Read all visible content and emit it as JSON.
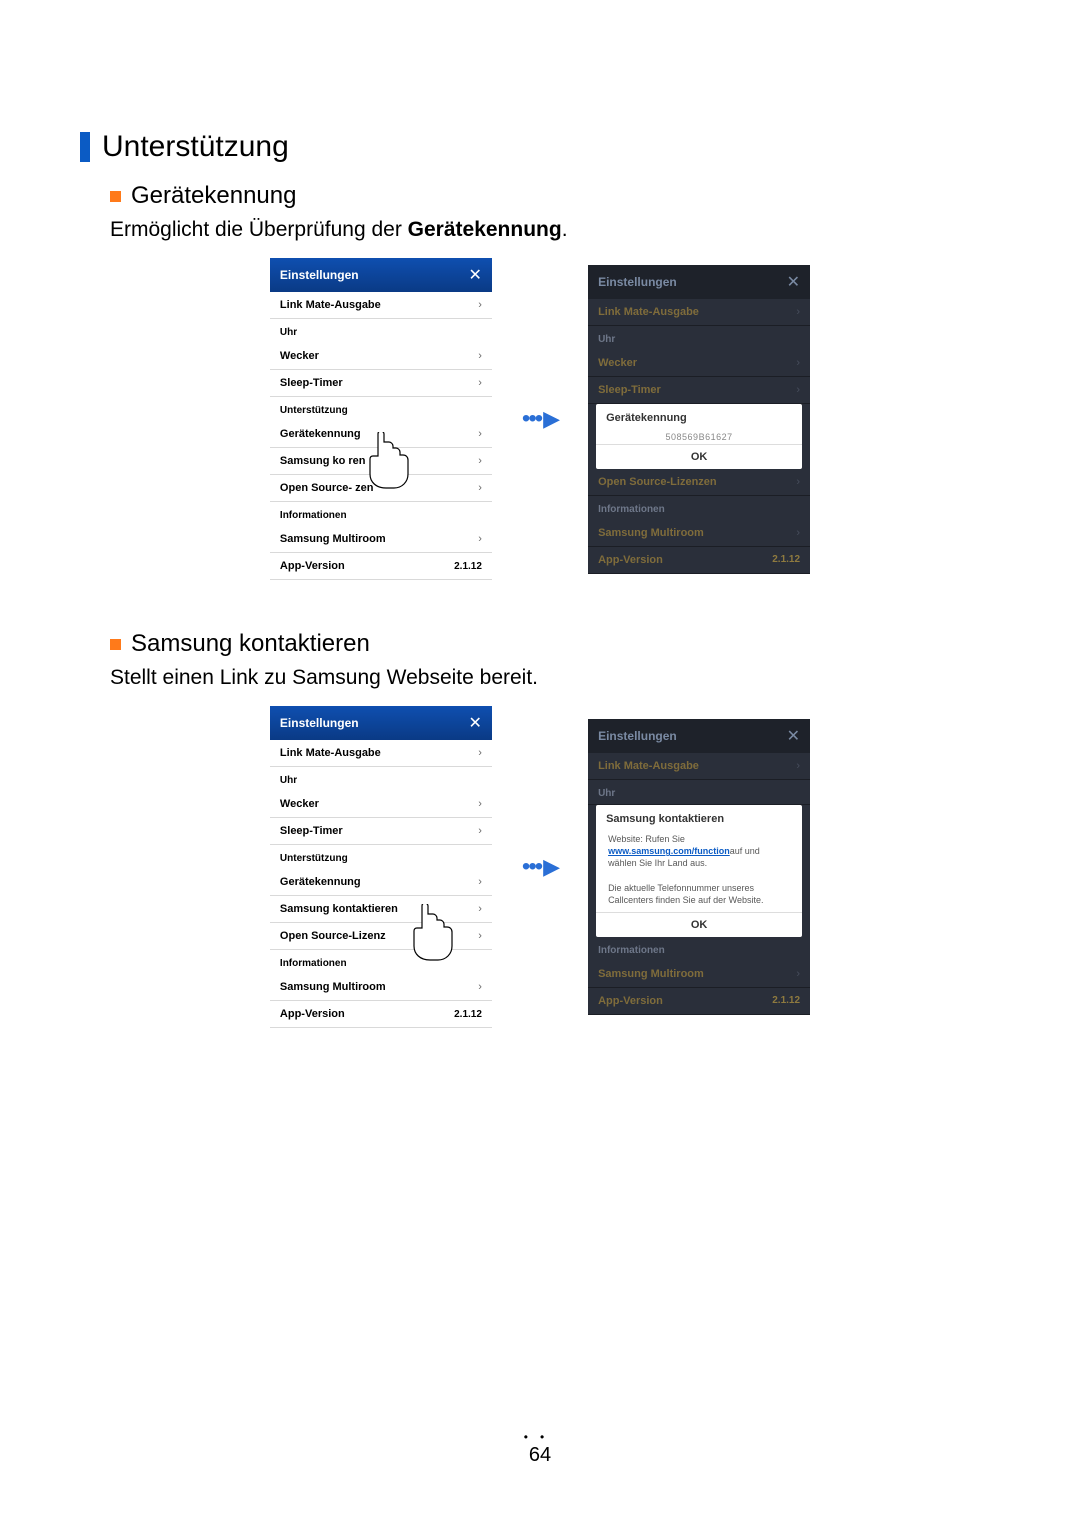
{
  "page": {
    "h1": "Unterstützung",
    "section1": {
      "title": "Gerätekennung",
      "desc_pre": "Ermöglicht die Überprüfung der ",
      "desc_bold": "Gerätekennung",
      "desc_post": "."
    },
    "section2": {
      "title": "Samsung kontaktieren",
      "desc": "Stellt einen Link zu Samsung Webseite bereit."
    },
    "footer_page": "64"
  },
  "common": {
    "header_title": "Einstellungen",
    "close_glyph": "✕",
    "chevron": "›",
    "group_clock": "Uhr",
    "group_support": "Unterstützung",
    "group_info": "Informationen",
    "link_mate": "Link Mate-Ausgabe",
    "wecker": "Wecker",
    "sleep_timer": "Sleep-Timer",
    "geratekennung": "Gerätekennung",
    "samsung_kont": "Samsung kontaktieren",
    "open_source": "Open Source-Lizenzen",
    "samsung_multiroom": "Samsung Multiroom",
    "app_version_label": "App-Version",
    "app_version_value": "2.1.12"
  },
  "fig1_left": {
    "kont_trunc": "Samsung ko          ren",
    "open_trunc": "Open Source-         zen"
  },
  "fig1_right": {
    "popup_title": "Gerätekennung",
    "device_id": "508569B61627",
    "ok": "OK"
  },
  "fig2_left": {
    "open_trunc": "Open Source-Lizenz"
  },
  "fig2_right": {
    "popup_title": "Samsung kontaktieren",
    "line1_a": "Website: Rufen Sie",
    "link": "www.samsung.com/function",
    "line1_b": "auf und wählen Sie Ihr Land aus.",
    "line2": "Die aktuelle Telefonnummer unseres Callcenters finden Sie auf der Website.",
    "ok": "OK"
  }
}
